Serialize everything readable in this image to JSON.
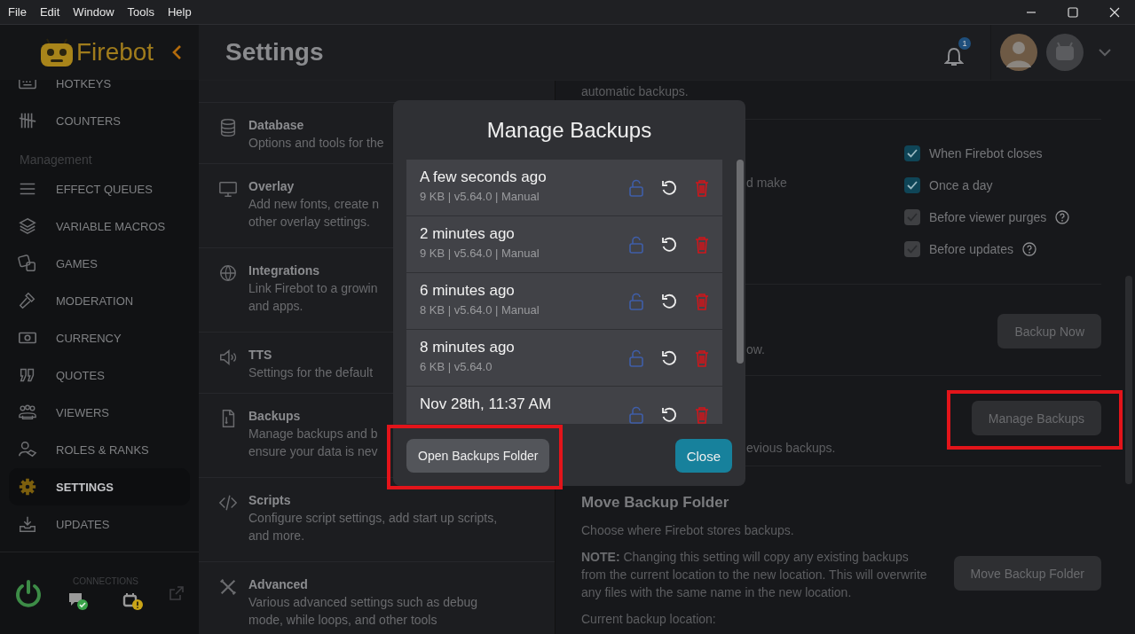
{
  "menu_bar": {
    "items": [
      "File",
      "Edit",
      "Window",
      "Tools",
      "Help"
    ]
  },
  "sidebar": {
    "brand": "Firebot",
    "items": [
      {
        "kind": "link",
        "label": "HOTKEYS",
        "selected": false
      },
      {
        "kind": "link",
        "label": "COUNTERS",
        "selected": false
      },
      {
        "kind": "heading",
        "label": "Management"
      },
      {
        "kind": "link",
        "label": "EFFECT QUEUES",
        "selected": false
      },
      {
        "kind": "link",
        "label": "VARIABLE MACROS",
        "selected": false
      },
      {
        "kind": "link",
        "label": "GAMES",
        "selected": false
      },
      {
        "kind": "link",
        "label": "MODERATION",
        "selected": false
      },
      {
        "kind": "link",
        "label": "CURRENCY",
        "selected": false
      },
      {
        "kind": "link",
        "label": "QUOTES",
        "selected": false
      },
      {
        "kind": "link",
        "label": "VIEWERS",
        "selected": false
      },
      {
        "kind": "link",
        "label": "ROLES & RANKS",
        "selected": false
      },
      {
        "kind": "link",
        "label": "SETTINGS",
        "selected": true
      },
      {
        "kind": "link",
        "label": "UPDATES",
        "selected": false
      }
    ],
    "connections": {
      "label": "CONNECTIONS",
      "services": [
        {
          "connected": true
        },
        {
          "connected": false
        }
      ]
    }
  },
  "header": {
    "title": "Settings",
    "notification_count": "1"
  },
  "categories": [
    {
      "title": "Database",
      "description_lines": [
        "Options and tools for the"
      ]
    },
    {
      "title": "Overlay",
      "description_lines": [
        "Add new fonts, create n",
        "other overlay settings."
      ]
    },
    {
      "title": "Integrations",
      "description_lines": [
        "Link Firebot to a growin",
        "and apps."
      ]
    },
    {
      "title": "TTS",
      "description_lines": [
        "Settings for the default"
      ]
    },
    {
      "title": "Backups",
      "description_lines": [
        "Manage backups and b",
        "ensure your data is nev"
      ]
    },
    {
      "title": "Scripts",
      "description_lines": [
        "Configure script settings, add start up scripts,",
        "and more."
      ]
    },
    {
      "title": "Advanced",
      "description_lines": [
        "Various advanced settings such as debug",
        "mode, while loops, and other tools"
      ]
    }
  ],
  "settings_panel": {
    "top_text": "automatic backups.",
    "auto_backup": {
      "fragment": "d make",
      "options": [
        {
          "label": "When Firebot closes",
          "checked": true,
          "disabled": false,
          "help": false
        },
        {
          "label": "Once a day",
          "checked": true,
          "disabled": false,
          "help": false
        },
        {
          "label": "Before viewer purges",
          "checked": true,
          "disabled": true,
          "help": true
        },
        {
          "label": "Before updates",
          "checked": true,
          "disabled": true,
          "help": true
        }
      ]
    },
    "backup_now": {
      "fragment": "ow.",
      "button": {
        "label": "Backup Now",
        "highlighted": false
      }
    },
    "manage": {
      "fragment": "evious backups.",
      "button": {
        "label": "Manage Backups",
        "highlighted": true
      }
    },
    "move": {
      "title": "Move Backup Folder",
      "description": "Choose where Firebot stores backups.",
      "note": "**NOTE:** Changing this setting will copy any existing backups from the current location to the new location. This will overwrite any files with the same name in the new location.",
      "button": {
        "label": "Move Backup Folder",
        "highlighted": false
      },
      "location_label": "Current backup location:"
    }
  },
  "modal": {
    "title": "Manage Backups",
    "backups": [
      {
        "when": "A few seconds ago",
        "details": "9 KB | v5.64.0 | Manual"
      },
      {
        "when": "2 minutes ago",
        "details": "9 KB | v5.64.0 | Manual"
      },
      {
        "when": "6 minutes ago",
        "details": "8 KB | v5.64.0 | Manual"
      },
      {
        "when": "8 minutes ago",
        "details": "6 KB | v5.64.0"
      },
      {
        "when": "Nov 28th, 11:37 AM"
      }
    ],
    "buttons": [
      {
        "kind": "secondary",
        "label": "Open Backups Folder",
        "highlighted": true
      },
      {
        "kind": "primary",
        "label": "Close",
        "highlighted": false
      }
    ]
  }
}
